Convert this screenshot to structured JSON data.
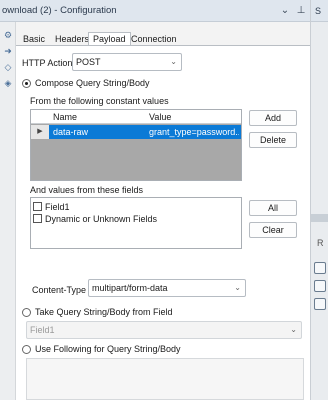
{
  "titlebar": {
    "title": "ownload (2) - Configuration",
    "dropdown_glyph": "⌄",
    "pin_glyph": "⊥"
  },
  "right_strip": {
    "top_letter": "S",
    "mid_letter": "R"
  },
  "tabs": [
    {
      "label": "Basic",
      "active": false
    },
    {
      "label": "Headers",
      "active": false
    },
    {
      "label": "Payload",
      "active": true
    },
    {
      "label": "Connection",
      "active": false
    }
  ],
  "http_action": {
    "label": "HTTP Action",
    "value": "POST"
  },
  "compose": {
    "label": "Compose Query String/Body",
    "constant_values_label": "From the following constant values",
    "grid": {
      "columns": [
        "Name",
        "Value"
      ],
      "rows": [
        {
          "name": "data-raw",
          "value": "grant_type=password..."
        }
      ],
      "row_marker": "▶"
    },
    "add_button": "Add",
    "delete_button": "Delete",
    "fields_label": "And values from these fields",
    "fields": [
      {
        "label": "Field1",
        "checked": false
      },
      {
        "label": "Dynamic or Unknown Fields",
        "checked": false
      }
    ],
    "all_button": "All",
    "clear_button": "Clear"
  },
  "content_type": {
    "label": "Content-Type",
    "value": "multipart/form-data"
  },
  "take_from_field": {
    "label": "Take Query String/Body from Field",
    "value": "Field1"
  },
  "use_following": {
    "label": "Use Following for Query String/Body"
  },
  "icons": {
    "dropdown": "chevron-down-icon",
    "pin": "pin-icon",
    "gear": "gear-icon",
    "arrow_right": "arrow-right-icon",
    "tag": "tag-icon",
    "diamond": "diamond-icon"
  }
}
